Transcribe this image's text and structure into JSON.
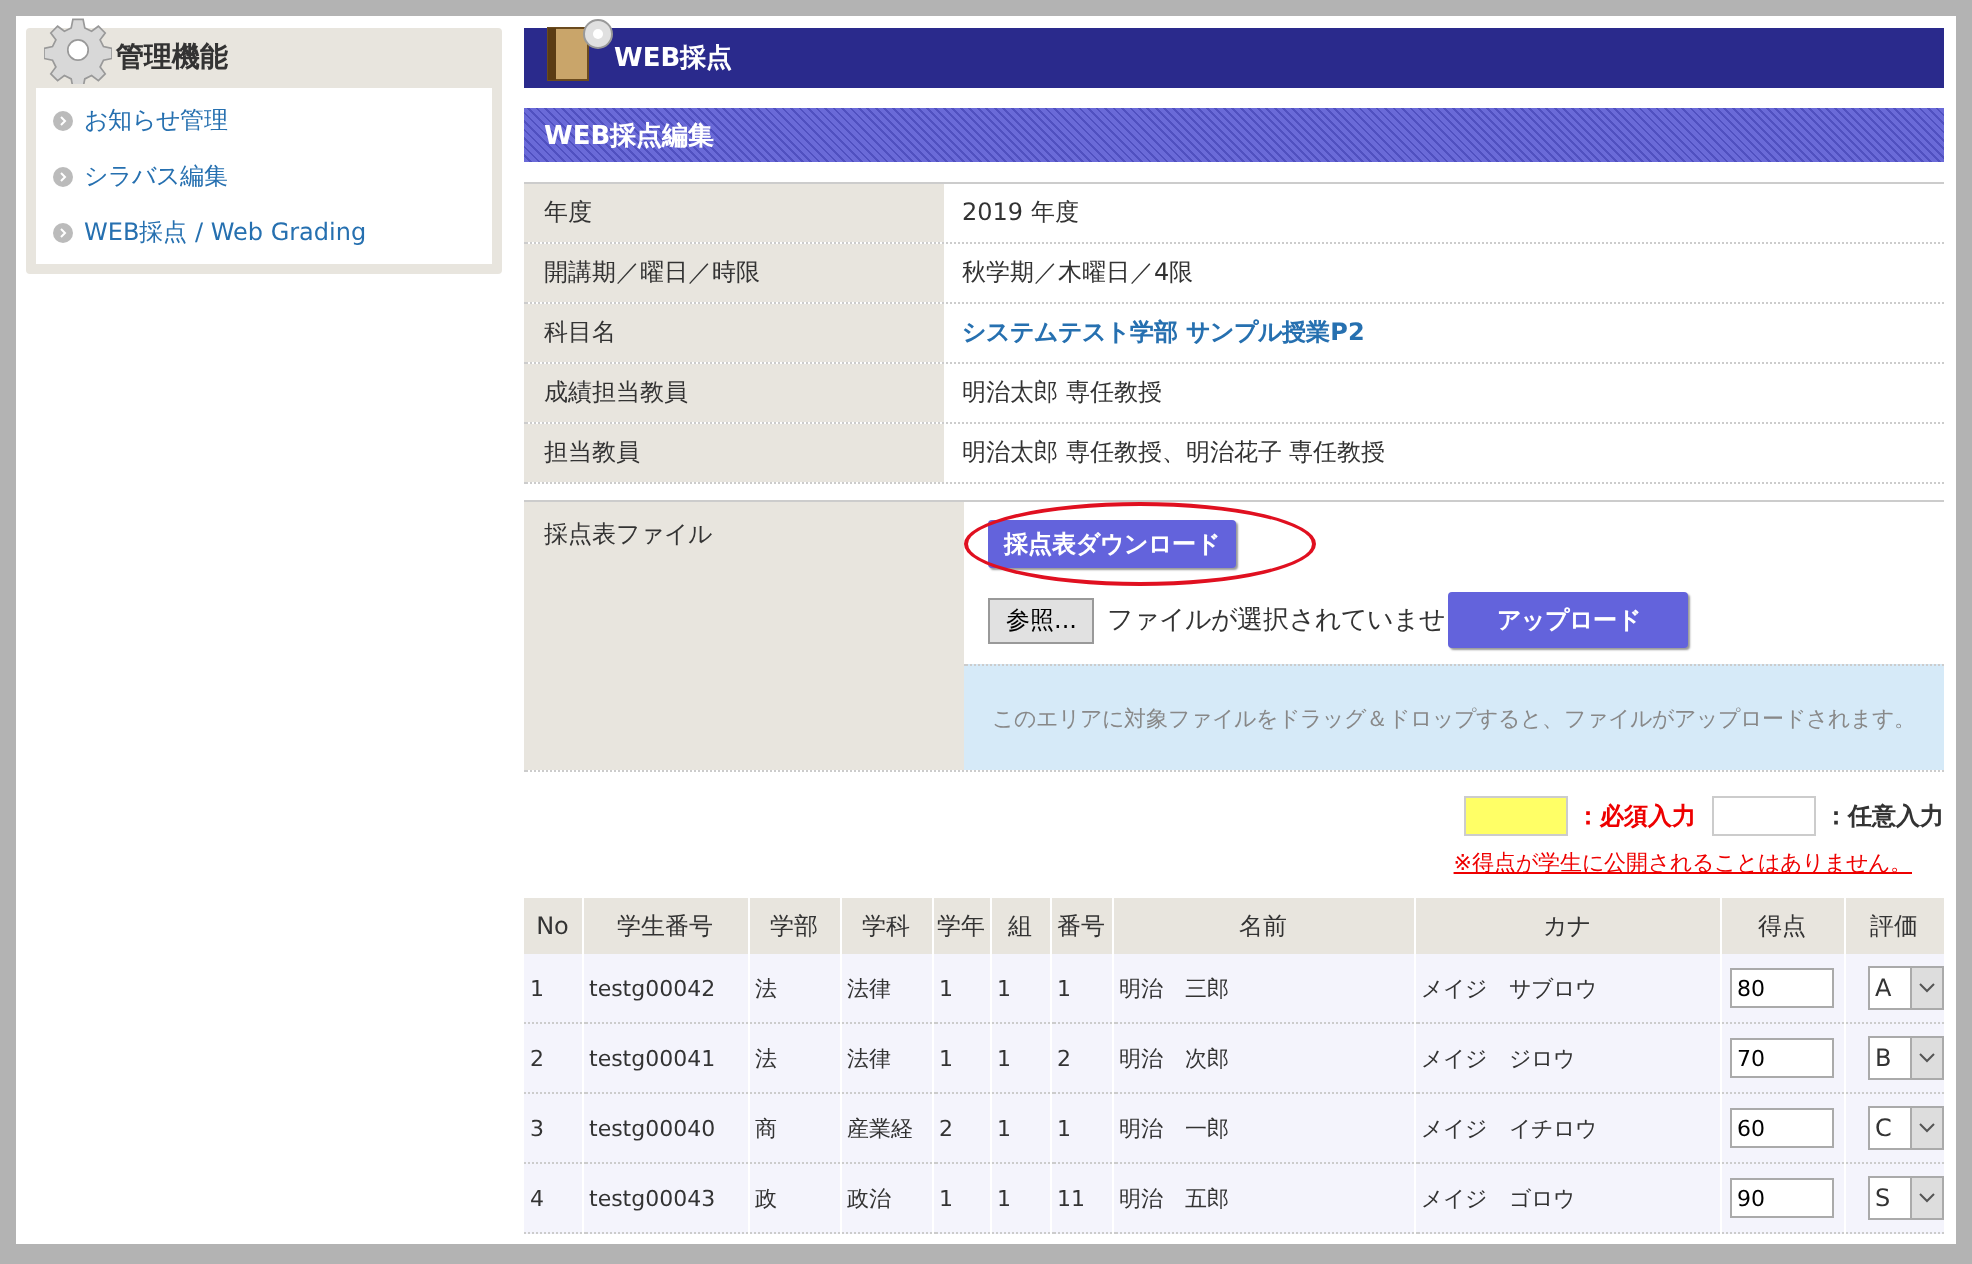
{
  "sidebar": {
    "title": "管理機能",
    "items": [
      {
        "label": "お知らせ管理"
      },
      {
        "label": "シラバス編集"
      },
      {
        "label": "WEB採点 / Web Grading"
      }
    ]
  },
  "page_title": "WEB採点",
  "section_title": "WEB採点編集",
  "info_rows": [
    {
      "label": "年度",
      "value": "2019 年度",
      "kind": "plain"
    },
    {
      "label": "開講期／曜日／時限",
      "value": "秋学期／木曜日／4限",
      "kind": "plain"
    },
    {
      "label": "科目名",
      "value": "システムテスト学部 サンプル授業P2",
      "kind": "link"
    },
    {
      "label": "成績担当教員",
      "value": "明治太郎 専任教授",
      "kind": "plain"
    },
    {
      "label": "担当教員",
      "value": "明治太郎 専任教授、明治花子 専任教授",
      "kind": "plain"
    }
  ],
  "file_section": {
    "label": "採点表ファイル",
    "download_button": "採点表ダウンロード",
    "browse_button": "参照...",
    "file_status": "ファイルが選択されていませ",
    "upload_button": "アップロード",
    "drop_hint": "このエリアに対象ファイルをドラッグ＆ドロップすると、ファイルがアップロードされます。"
  },
  "legend": {
    "required": "：必須入力",
    "optional": "：任意入力",
    "notice": "※得点が学生に公開されることはありません。"
  },
  "table": {
    "columns": [
      "No",
      "学生番号",
      "学部",
      "学科",
      "学年",
      "組",
      "番号",
      "名前",
      "カナ",
      "得点",
      "評価"
    ],
    "rows": [
      {
        "cells": [
          "1",
          "testg00042",
          "法",
          "法律",
          "1",
          "1",
          "1",
          "明治　三郎",
          "メイジ　サブロウ"
        ],
        "score": "80",
        "grade": "A"
      },
      {
        "cells": [
          "2",
          "testg00041",
          "法",
          "法律",
          "1",
          "1",
          "2",
          "明治　次郎",
          "メイジ　ジロウ"
        ],
        "score": "70",
        "grade": "B"
      },
      {
        "cells": [
          "3",
          "testg00040",
          "商",
          "産業経",
          "2",
          "1",
          "1",
          "明治　一郎",
          "メイジ　イチロウ"
        ],
        "score": "60",
        "grade": "C"
      },
      {
        "cells": [
          "4",
          "testg00043",
          "政",
          "政治",
          "1",
          "1",
          "11",
          "明治　五郎",
          "メイジ　ゴロウ"
        ],
        "score": "90",
        "grade": "S"
      }
    ]
  }
}
